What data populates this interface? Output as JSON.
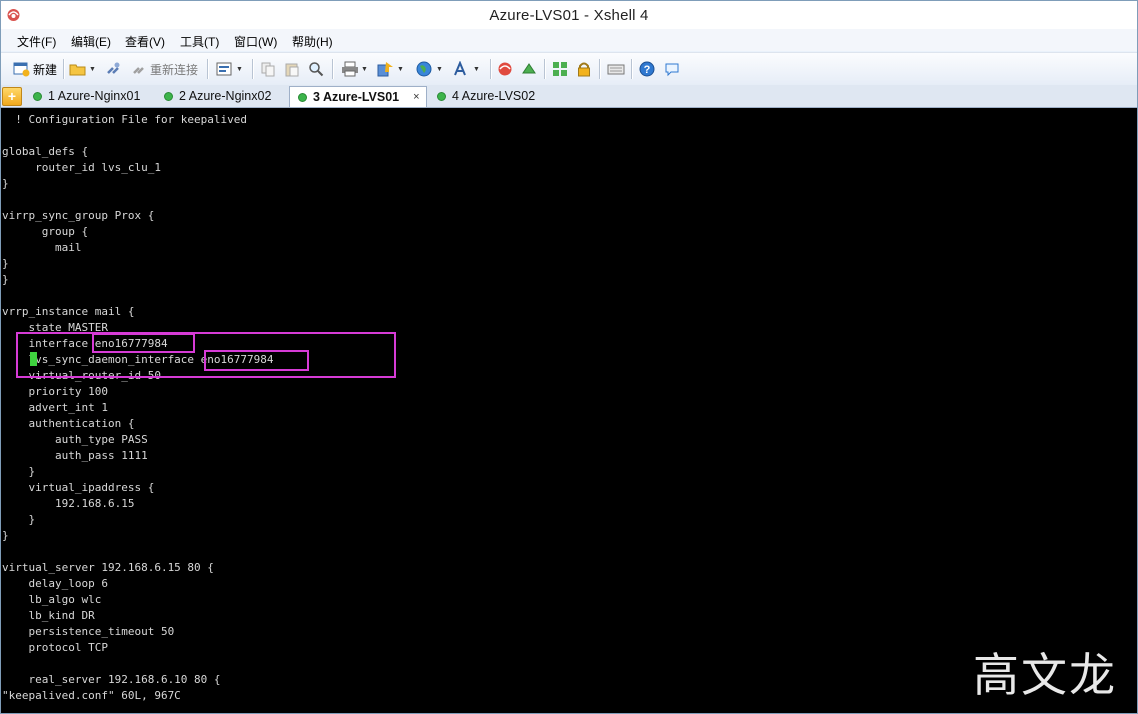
{
  "window": {
    "title": "Azure-LVS01 - Xshell 4"
  },
  "menu": [
    "文件(F)",
    "编辑(E)",
    "查看(V)",
    "工具(T)",
    "窗口(W)",
    "帮助(H)"
  ],
  "toolbar": {
    "new_label": "新建",
    "reconnect_label": "重新连接"
  },
  "tabs": [
    {
      "label": "1 Azure-Nginx01"
    },
    {
      "label": "2 Azure-Nginx02"
    },
    {
      "label": "3 Azure-LVS01",
      "active": true,
      "close": "×"
    },
    {
      "label": "4 Azure-LVS02"
    }
  ],
  "terminal": {
    "lines": [
      "  ! Configuration File for keepalived",
      "",
      "global_defs {",
      "     router_id lvs_clu_1",
      "}",
      "",
      "virrp_sync_group Prox {",
      "      group {",
      "        mail",
      "}",
      "}",
      "",
      "vrrp_instance mail {",
      "    state MASTER",
      "    interface eno16777984",
      "    lvs_sync_daemon_interface eno16777984",
      "    virtual_router_id 50",
      "    priority 100",
      "    advert_int 1",
      "    authentication {",
      "        auth_type PASS",
      "        auth_pass 1111",
      "    }",
      "    virtual_ipaddress {",
      "        192.168.6.15",
      "    }",
      "}",
      "",
      "virtual_server 192.168.6.15 80 {",
      "    delay_loop 6",
      "    lb_algo wlc",
      "    lb_kind DR",
      "    persistence_timeout 50",
      "    protocol TCP",
      "",
      "    real_server 192.168.6.10 80 {",
      "\"keepalived.conf\" 60L, 967C"
    ]
  },
  "watermark": "高文龙",
  "colors": {
    "terminal_bg": "#000000",
    "terminal_fg": "#d8d8d8",
    "highlight": "#d63bd6",
    "cursor": "#3fd33f"
  }
}
